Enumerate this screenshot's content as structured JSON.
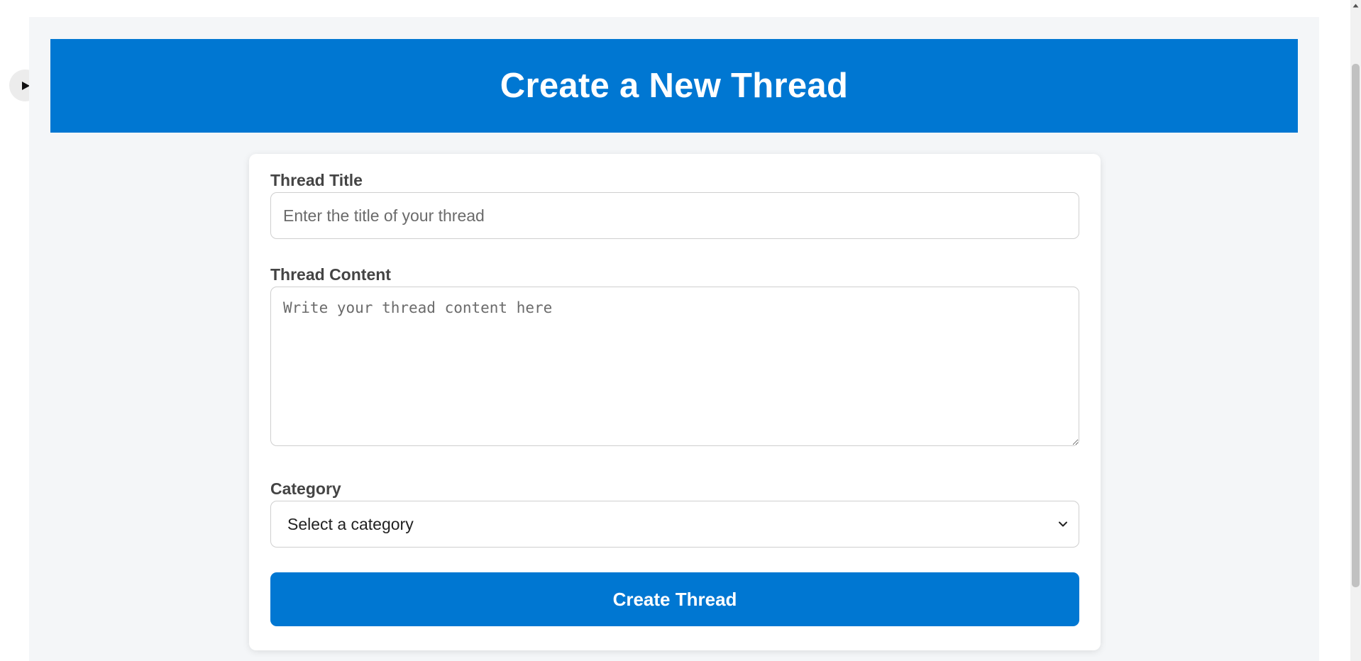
{
  "page": {
    "header_title": "Create a New Thread"
  },
  "form": {
    "title_label": "Thread Title",
    "title_placeholder": "Enter the title of your thread",
    "title_value": "",
    "content_label": "Thread Content",
    "content_placeholder": "Write your thread content here",
    "content_value": "",
    "category_label": "Category",
    "category_selected": "Select a category",
    "submit_label": "Create Thread"
  },
  "icons": {
    "play": "play-icon",
    "dropdown": "chevron-down-icon",
    "scroll_up": "scroll-up-arrow-icon"
  },
  "colors": {
    "accent": "#0077d2",
    "page_background": "#f4f6f8",
    "card_background": "#ffffff",
    "label_text": "#444444"
  }
}
